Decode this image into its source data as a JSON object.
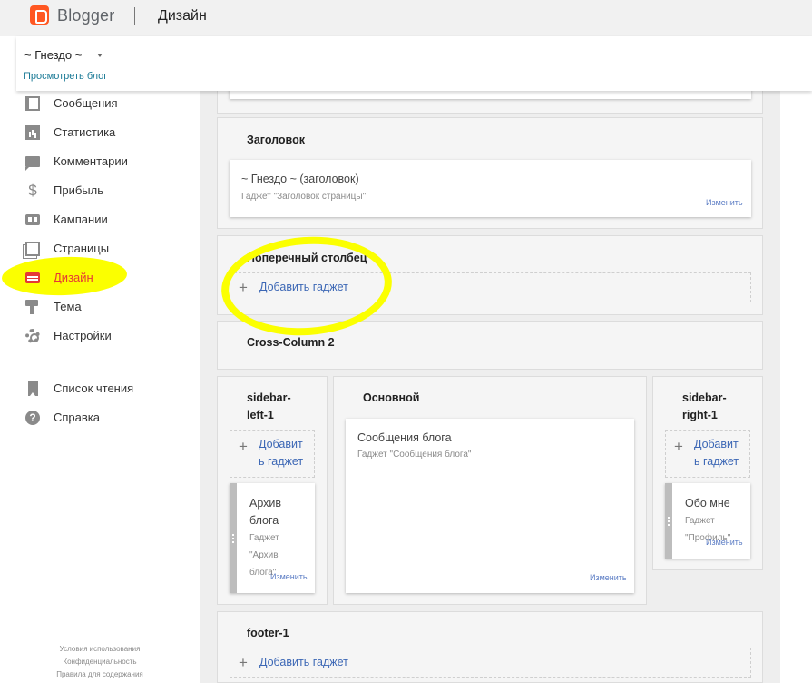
{
  "app": {
    "brand": "Blogger",
    "section": "Дизайн"
  },
  "blog": {
    "name": "~ Гнездо ~",
    "view_link": "Просмотреть блог"
  },
  "nav": {
    "items": [
      {
        "label": "Сообщения",
        "icon": "posts-icon"
      },
      {
        "label": "Статистика",
        "icon": "stats-icon"
      },
      {
        "label": "Комментарии",
        "icon": "comments-icon"
      },
      {
        "label": "Прибыль",
        "icon": "earnings-icon"
      },
      {
        "label": "Кампании",
        "icon": "campaigns-icon"
      },
      {
        "label": "Страницы",
        "icon": "pages-icon"
      },
      {
        "label": "Дизайн",
        "icon": "layout-icon",
        "active": true
      },
      {
        "label": "Тема",
        "icon": "theme-icon"
      },
      {
        "label": "Настройки",
        "icon": "settings-icon"
      },
      {
        "label": "Список чтения",
        "icon": "reading-list-icon"
      },
      {
        "label": "Справка",
        "icon": "help-icon"
      }
    ],
    "earnings_glyph": "$",
    "help_glyph": "?"
  },
  "footer": {
    "links": [
      "Условия использования",
      "Конфиденциальность",
      "Правила для содержания"
    ]
  },
  "layout": {
    "header_section": {
      "title": "Заголовок",
      "gadget_title": "~ Гнездо ~ (заголовок)",
      "gadget_sub": "Гаджет \"Заголовок страницы\"",
      "edit": "Изменить"
    },
    "cross_column": {
      "title": "Поперечный столбец",
      "add": "Добавить гаджет"
    },
    "cross_column_2": {
      "title": "Cross-Column 2"
    },
    "sidebar_left": {
      "title_1": "sidebar-",
      "title_2": "left-1",
      "add_1": "Добавит",
      "add_2": "ь гаджет",
      "gadget_title_1": "Архив",
      "gadget_title_2": "блога",
      "gadget_sub_1": "Гаджет",
      "gadget_sub_2": "\"Архив",
      "gadget_sub_3": "блога\"",
      "edit": "Изменить"
    },
    "main": {
      "title": "Основной",
      "gadget_title": "Сообщения блога",
      "gadget_sub": "Гаджет \"Сообщения блога\"",
      "edit": "Изменить"
    },
    "sidebar_right": {
      "title_1": "sidebar-",
      "title_2": "right-1",
      "add_1": "Добавит",
      "add_2": "ь гаджет",
      "gadget_title": "Обо мне",
      "gadget_sub_1": "Гаджет",
      "gadget_sub_2": "\"Профиль\"",
      "edit": "Изменить"
    },
    "footer_section": {
      "title": "footer-1",
      "add": "Добавить гаджет"
    },
    "plus_glyph": "+"
  },
  "colors": {
    "brand": "#ff5722",
    "active": "#e53935",
    "link": "#3c67b5",
    "highlight": "#fbff00"
  }
}
